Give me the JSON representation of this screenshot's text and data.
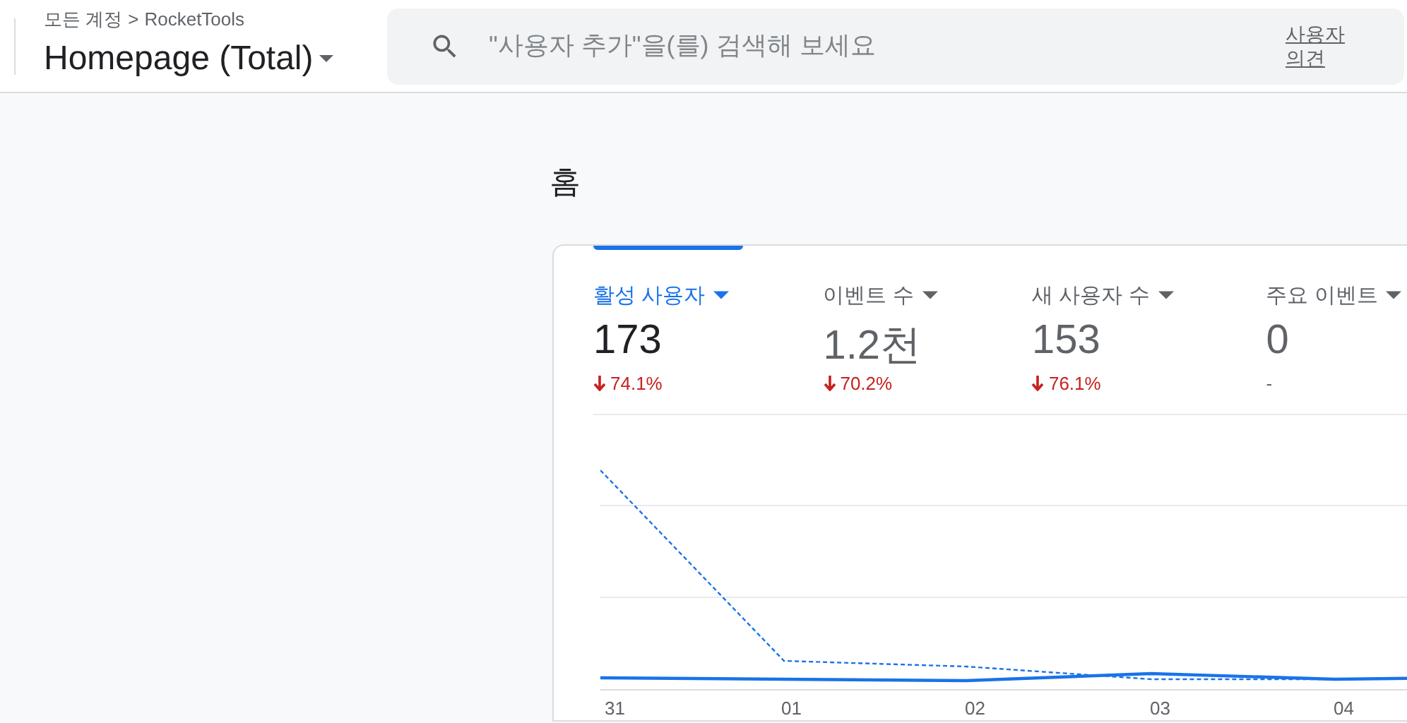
{
  "header": {
    "breadcrumb": {
      "parent": "모든 계정",
      "separator": ">",
      "current": "RocketTools"
    },
    "property": "Homepage (Total)",
    "search": {
      "placeholder": "\"사용자 추가\"을(를) 검색해 보세요"
    },
    "feedback": "사용자 의견"
  },
  "page_title": "홈",
  "metrics": [
    {
      "label": "활성 사용자",
      "value": "173",
      "change": "74.1%",
      "kind": "decrease",
      "selected": true
    },
    {
      "label": "이벤트 수",
      "value": "1.2천",
      "change": "70.2%",
      "kind": "decrease",
      "selected": false
    },
    {
      "label": "새 사용자 수",
      "value": "153",
      "change": "76.1%",
      "kind": "decrease",
      "selected": false
    },
    {
      "label": "주요 이벤트",
      "value": "0",
      "change": "-",
      "kind": "flat",
      "selected": false
    }
  ],
  "chart": {
    "x_labels": [
      "31",
      "01",
      "02",
      "03",
      "04"
    ]
  }
}
